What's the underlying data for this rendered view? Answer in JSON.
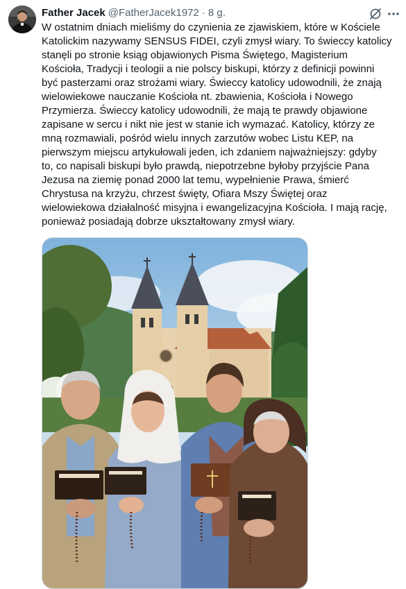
{
  "tweet": {
    "author": {
      "display_name": "Father Jacek",
      "handle": "@FatherJacek1972",
      "separator": "·",
      "time": "8 g."
    },
    "icons": {
      "grok": "grok-icon",
      "more": "more-icon"
    },
    "text_lines": [
      "W ostatnim dniach mieliśmy do czynienia ze zjawiskiem, które w Kościele",
      "Katolickim nazywamy SENSUS FIDEI, czyli zmysł wiary. To świeccy katolicy",
      "stanęli po stronie ksiąg objawionych Pisma Świętego, Magisterium",
      "Kościoła, Tradycji i teologii a nie polscy biskupi, którzy z definicji powinni",
      "być pasterzami oraz strożami wiary. Świeccy katolicy udowodnili, że znają",
      "wielowiekowe nauczanie Kościoła nt. zbawienia, Kościoła i Nowego",
      "Przymierza. Świeccy katolicy udowodnili, że mają te prawdy objawione",
      "zapisane w sercu i nikt nie jest w stanie ich wymazać. Katolicy, którzy ze",
      "mną rozmawiali, pośród wielu innych zarzutów wobec Listu KEP, na",
      "pierwszym miejscu artykułowali jeden, ich zdaniem najważniejszy: gdyby",
      "to, co napisali biskupi było prawdą, niepotrzebne byłoby przyjście Pana",
      "Jezusa na ziemię ponad 2000 lat temu, wypełnienie Prawa, śmierć",
      "Chrystusa na krzyżu, chrzest święty, Ofiara Mszy Świętej oraz",
      "wielowiekowa działalność misyjna i ewangelizacyjna Kościoła. I mają rację,",
      "ponieważ posiadają dobrze ukształtowany zmysł wiary."
    ]
  },
  "colors": {
    "text": "#0f1419",
    "secondary": "#536471",
    "border": "#cfd9de"
  }
}
